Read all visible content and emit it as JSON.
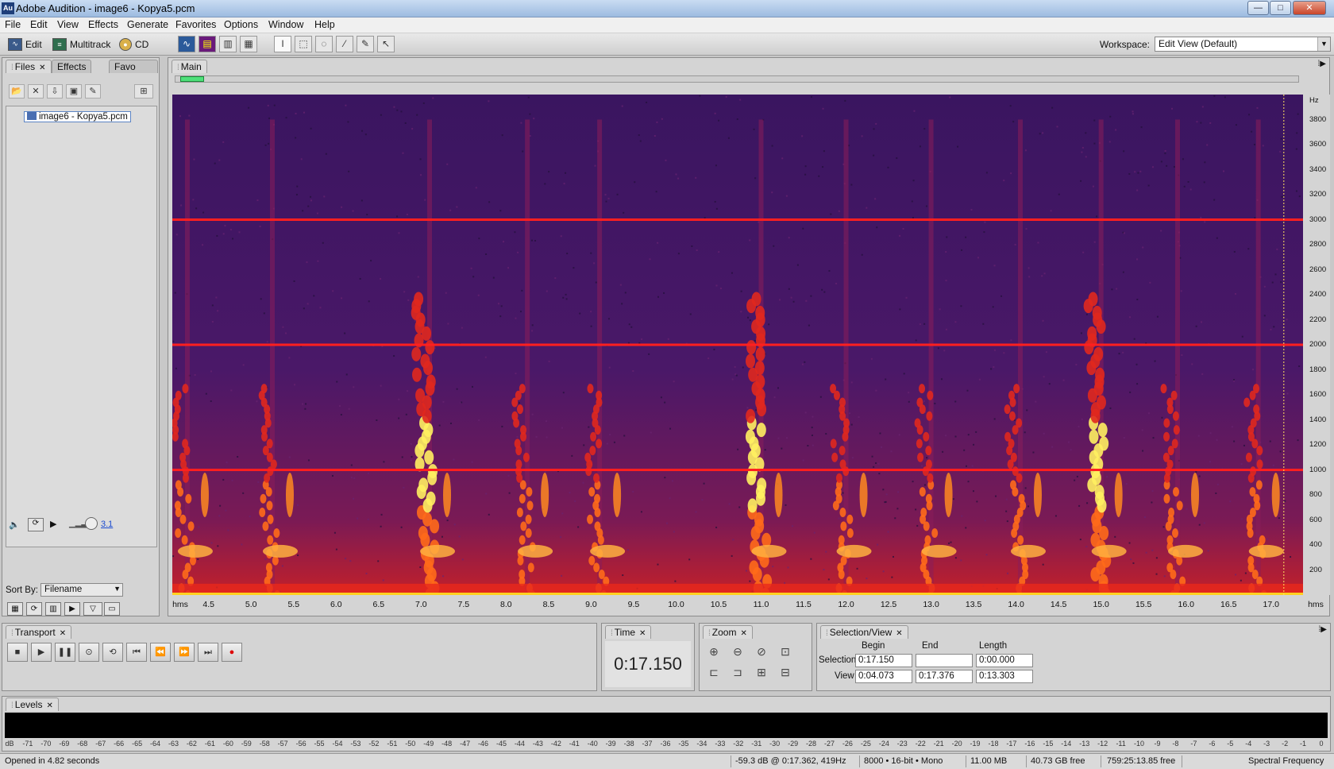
{
  "window": {
    "title": "Adobe Audition - image6 - Kopya5.pcm",
    "logo": "Au",
    "controls": {
      "minimize": "—",
      "maximize": "□",
      "close": "✕"
    }
  },
  "menu": [
    "File",
    "Edit",
    "View",
    "Effects",
    "Generate",
    "Favorites",
    "Options",
    "Window",
    "Help"
  ],
  "toolbar": {
    "views": [
      {
        "label": "Edit",
        "icon": "waveform-edit-icon"
      },
      {
        "label": "Multitrack",
        "icon": "multitrack-icon"
      },
      {
        "label": "CD",
        "icon": "cd-icon"
      }
    ],
    "workspace_label": "Workspace:",
    "workspace_value": "Edit View (Default)"
  },
  "files_panel": {
    "tabs": [
      "Files",
      "Effects",
      "Favo"
    ],
    "file": "image6 - Kopya5.pcm",
    "volume_value": "3.1",
    "sort_label": "Sort By:",
    "sort_value": "Filename"
  },
  "main_panel": {
    "tab": "Main",
    "hz_unit": "Hz",
    "hz_labels": [
      "3800",
      "3600",
      "3400",
      "3200",
      "3000",
      "2800",
      "2600",
      "2400",
      "2200",
      "2000",
      "1800",
      "1600",
      "1400",
      "1200",
      "1000",
      "800",
      "600",
      "400",
      "200"
    ],
    "time_unit": "hms",
    "time_labels": [
      "4.5",
      "5.0",
      "5.5",
      "6.0",
      "6.5",
      "7.0",
      "7.5",
      "8.0",
      "8.5",
      "9.0",
      "9.5",
      "10.0",
      "10.5",
      "11.0",
      "11.5",
      "12.0",
      "12.5",
      "13.0",
      "13.5",
      "14.0",
      "14.5",
      "15.0",
      "15.5",
      "16.0",
      "16.5",
      "17.0"
    ],
    "view_range": [
      4.073,
      17.376
    ],
    "freq_range": [
      0,
      4000
    ],
    "playhead_time": 17.15,
    "tone_lines_hz": [
      1000,
      2000,
      3000
    ],
    "colors": {
      "background": "#3a1560",
      "tone": "#ff1f1f",
      "hot": "#fff060"
    }
  },
  "transport": {
    "tab": "Transport"
  },
  "time": {
    "tab": "Time",
    "value": "0:17.150"
  },
  "zoom": {
    "tab": "Zoom"
  },
  "selection_view": {
    "tab": "Selection/View",
    "headers": [
      "Begin",
      "End",
      "Length"
    ],
    "selection_label": "Selection",
    "view_label": "View",
    "selection": {
      "begin": "0:17.150",
      "end": "",
      "length": "0:00.000"
    },
    "view": {
      "begin": "0:04.073",
      "end": "0:17.376",
      "length": "0:13.303"
    }
  },
  "levels": {
    "tab": "Levels",
    "scale": [
      "dB",
      "-71",
      "-70",
      "-69",
      "-68",
      "-67",
      "-66",
      "-65",
      "-64",
      "-63",
      "-62",
      "-61",
      "-60",
      "-59",
      "-58",
      "-57",
      "-56",
      "-55",
      "-54",
      "-53",
      "-52",
      "-51",
      "-50",
      "-49",
      "-48",
      "-47",
      "-46",
      "-45",
      "-44",
      "-43",
      "-42",
      "-41",
      "-40",
      "-39",
      "-38",
      "-37",
      "-36",
      "-35",
      "-34",
      "-33",
      "-32",
      "-31",
      "-30",
      "-29",
      "-28",
      "-27",
      "-26",
      "-25",
      "-24",
      "-23",
      "-22",
      "-21",
      "-20",
      "-19",
      "-18",
      "-17",
      "-16",
      "-15",
      "-14",
      "-13",
      "-12",
      "-11",
      "-10",
      "-9",
      "-8",
      "-7",
      "-6",
      "-5",
      "-4",
      "-3",
      "-2",
      "-1",
      "0"
    ]
  },
  "status": {
    "message": "Opened in 4.82 seconds",
    "cursor": "-59.3 dB @ 0:17.362, 419Hz",
    "format": "8000 • 16-bit • Mono",
    "size": "11.00 MB",
    "disk_free": "40.73 GB free",
    "time_free": "759:25:13.85 free",
    "view_mode": "Spectral Frequency"
  }
}
